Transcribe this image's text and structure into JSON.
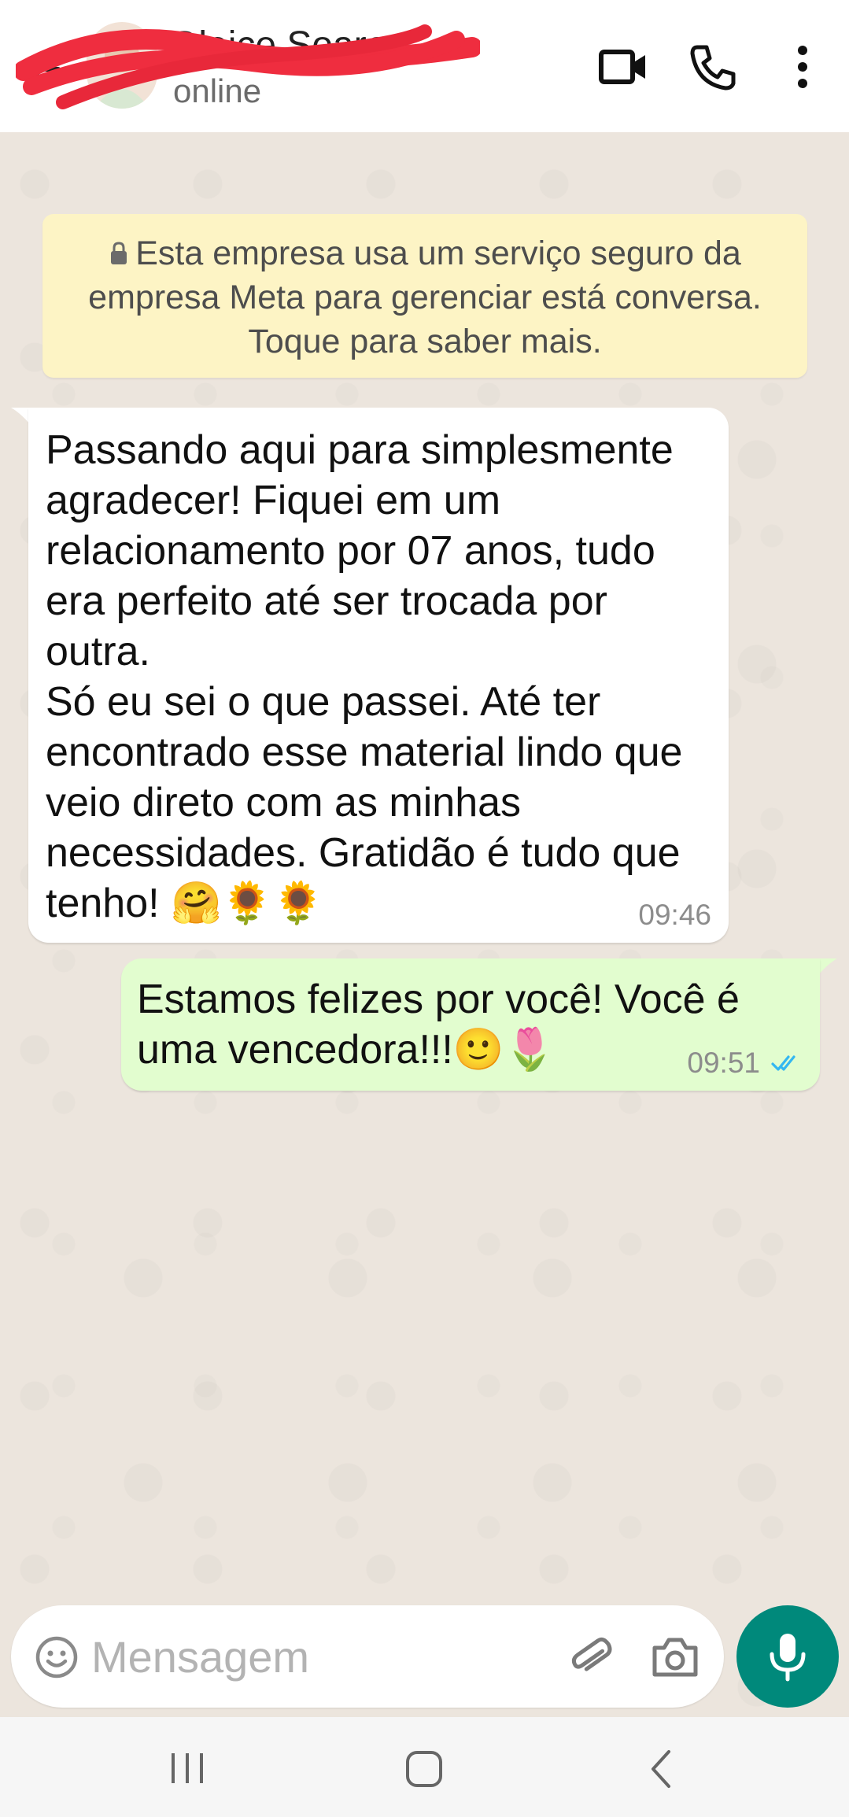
{
  "header": {
    "contact_name": "Gleice Soares",
    "status": "online",
    "icons": [
      "back-arrow-icon",
      "video-call-icon",
      "phone-call-icon",
      "more-options-icon"
    ]
  },
  "notice": {
    "text": "Esta empresa usa um serviço seguro da empresa Meta para gerenciar está conversa. Toque para saber mais."
  },
  "messages": [
    {
      "direction": "incoming",
      "text": "Passando aqui para simplesmente agradecer! Fiquei em um relacionamento por 07 anos, tudo era perfeito até ser trocada por outra.\nSó eu sei o que passei. Até ter encontrado esse material lindo que veio direto com as minhas necessidades. Gratidão é tudo que tenho! 🤗🌻🌻",
      "time": "09:46"
    },
    {
      "direction": "outgoing",
      "text": "Estamos felizes por você! Você é uma vencedora!!!🙂🌷",
      "time": "09:51",
      "status": "read"
    }
  ],
  "composer": {
    "placeholder": "Mensagem",
    "icons": [
      "emoji-icon",
      "attach-icon",
      "camera-icon",
      "mic-icon"
    ]
  },
  "colors": {
    "chat_background": "#ece5dd",
    "incoming_bubble": "#ffffff",
    "outgoing_bubble": "#e2fdcf",
    "notice_background": "#fdf4c5",
    "mic_button": "#00897b",
    "read_ticks": "#34b7f1"
  }
}
